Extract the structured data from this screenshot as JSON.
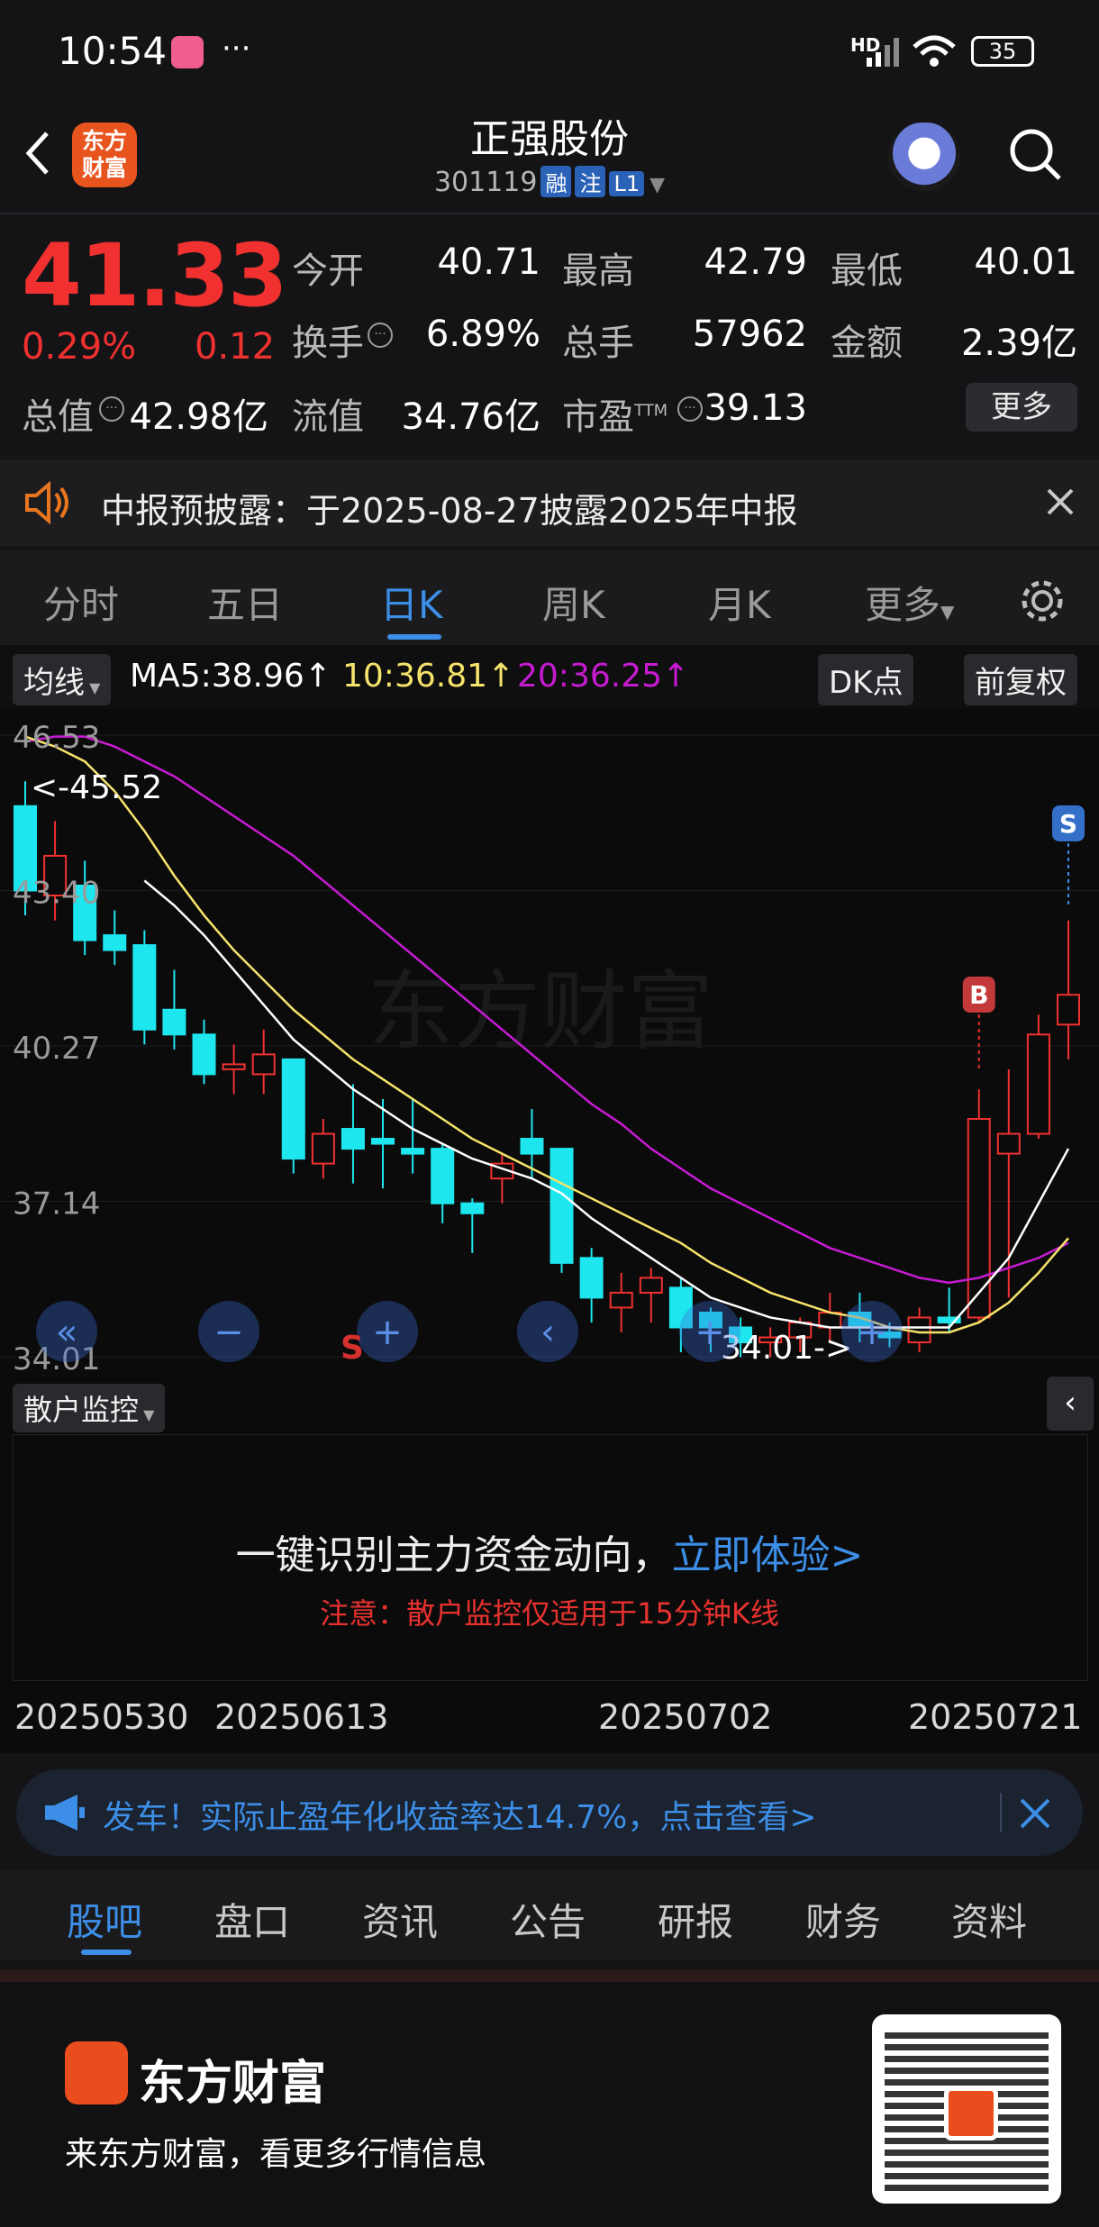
{
  "status_bar": {
    "time": "10:54",
    "app_badge": "bilibili",
    "dots": "···",
    "network": "HD",
    "battery": "35"
  },
  "header": {
    "back_icon": "chevron-left-icon",
    "logo_text": "东方\n财富",
    "title": "正强股份",
    "code": "301119",
    "tags": [
      "融",
      "注",
      "L1"
    ],
    "dropdown_icon": "caret-down-icon",
    "robot_icon": "robot-avatar-icon",
    "search_icon": "search-icon"
  },
  "quote": {
    "price": "41.33",
    "change_pct": "0.29%",
    "change": "0.12",
    "open_label": "今开",
    "open": "40.71",
    "high_label": "最高",
    "high": "42.79",
    "low_label": "最低",
    "low": "40.01",
    "turnover_label": "换手",
    "turnover": "6.89%",
    "volume_label": "总手",
    "volume": "57962",
    "amount_label": "金额",
    "amount": "2.39亿",
    "mktcap_label": "总值",
    "mktcap": "42.98亿",
    "float_label": "流值",
    "float": "34.76亿",
    "pe_label": "市盈",
    "pe_sup": "TTM",
    "pe": "39.13",
    "more": "更多"
  },
  "notice": {
    "text": "中报预披露：于2025-08-27披露2025年中报"
  },
  "tabs": [
    "分时",
    "五日",
    "日K",
    "周K",
    "月K",
    "更多"
  ],
  "active_tab": 2,
  "chart_toolbar": {
    "ma_select": "均线",
    "ma5": "MA5:38.96↑",
    "ma10": "10:36.81↑",
    "ma20": "20:36.25↑",
    "dk": "DK点",
    "adjust": "前复权"
  },
  "chart_data": {
    "type": "candlestick",
    "y_ticks": [
      "46.53",
      "43.40",
      "40.27",
      "37.14",
      "34.01"
    ],
    "ylim": [
      34.01,
      46.53
    ],
    "max_marker": "<-45.52",
    "min_marker": "34.01->",
    "x_ticks": [
      "20250530",
      "20250613",
      "20250702",
      "20250721"
    ],
    "buy_marker": "B",
    "sell_marker": "S",
    "candles": [
      {
        "o": 45.1,
        "c": 43.4,
        "h": 45.6,
        "l": 42.9
      },
      {
        "o": 43.3,
        "c": 44.1,
        "h": 44.8,
        "l": 42.8
      },
      {
        "o": 43.5,
        "c": 42.4,
        "h": 44.0,
        "l": 42.1
      },
      {
        "o": 42.5,
        "c": 42.2,
        "h": 43.0,
        "l": 41.9
      },
      {
        "o": 42.3,
        "c": 40.6,
        "h": 42.6,
        "l": 40.3
      },
      {
        "o": 41.0,
        "c": 40.5,
        "h": 41.8,
        "l": 40.2
      },
      {
        "o": 40.5,
        "c": 39.7,
        "h": 40.8,
        "l": 39.5
      },
      {
        "o": 39.8,
        "c": 39.9,
        "h": 40.3,
        "l": 39.3
      },
      {
        "o": 39.7,
        "c": 40.1,
        "h": 40.6,
        "l": 39.3
      },
      {
        "o": 40.0,
        "c": 38.0,
        "h": 40.0,
        "l": 37.7
      },
      {
        "o": 37.9,
        "c": 38.5,
        "h": 38.8,
        "l": 37.6
      },
      {
        "o": 38.6,
        "c": 38.2,
        "h": 39.5,
        "l": 37.5
      },
      {
        "o": 38.4,
        "c": 38.3,
        "h": 39.2,
        "l": 37.4
      },
      {
        "o": 38.2,
        "c": 38.1,
        "h": 39.2,
        "l": 37.7
      },
      {
        "o": 38.2,
        "c": 37.1,
        "h": 38.3,
        "l": 36.7
      },
      {
        "o": 37.1,
        "c": 36.9,
        "h": 37.2,
        "l": 36.1
      },
      {
        "o": 37.6,
        "c": 37.9,
        "h": 38.1,
        "l": 37.1
      },
      {
        "o": 38.4,
        "c": 38.1,
        "h": 39.0,
        "l": 37.6
      },
      {
        "o": 38.2,
        "c": 35.9,
        "h": 38.2,
        "l": 35.7
      },
      {
        "o": 36.0,
        "c": 35.2,
        "h": 36.2,
        "l": 34.7
      },
      {
        "o": 35.0,
        "c": 35.3,
        "h": 35.7,
        "l": 34.5
      },
      {
        "o": 35.3,
        "c": 35.6,
        "h": 35.8,
        "l": 34.7
      },
      {
        "o": 35.4,
        "c": 34.6,
        "h": 35.6,
        "l": 34.1
      },
      {
        "o": 34.9,
        "c": 34.6,
        "h": 35.0,
        "l": 34.1
      },
      {
        "o": 34.6,
        "c": 34.3,
        "h": 34.8,
        "l": 34.0
      },
      {
        "o": 34.3,
        "c": 34.4,
        "h": 34.6,
        "l": 34.0
      },
      {
        "o": 34.4,
        "c": 34.7,
        "h": 34.8,
        "l": 34.1
      },
      {
        "o": 34.6,
        "c": 34.9,
        "h": 35.3,
        "l": 34.3
      },
      {
        "o": 34.9,
        "c": 34.6,
        "h": 35.3,
        "l": 34.3
      },
      {
        "o": 34.5,
        "c": 34.4,
        "h": 34.7,
        "l": 34.2
      },
      {
        "o": 34.3,
        "c": 34.8,
        "h": 35.0,
        "l": 34.1
      },
      {
        "o": 34.8,
        "c": 34.7,
        "h": 35.4,
        "l": 34.5
      },
      {
        "o": 34.8,
        "c": 38.8,
        "h": 39.4,
        "l": 34.7
      },
      {
        "o": 38.1,
        "c": 38.5,
        "h": 39.8,
        "l": 35.2
      },
      {
        "o": 38.5,
        "c": 40.5,
        "h": 40.9,
        "l": 38.4
      },
      {
        "o": 40.7,
        "c": 41.3,
        "h": 42.8,
        "l": 40.0
      }
    ],
    "ma5": [
      null,
      null,
      null,
      null,
      43.6,
      43.1,
      42.5,
      41.8,
      41.1,
      40.4,
      39.9,
      39.4,
      39.0,
      38.6,
      38.3,
      38.0,
      37.8,
      37.6,
      37.3,
      36.8,
      36.4,
      36.0,
      35.6,
      35.2,
      35.0,
      34.8,
      34.7,
      34.6,
      34.6,
      34.6,
      34.6,
      34.6,
      35.3,
      36.0,
      37.1,
      38.2
    ],
    "ma10": [
      46.5,
      46.3,
      46.0,
      45.4,
      44.6,
      43.7,
      42.9,
      42.2,
      41.6,
      41.0,
      40.5,
      40.0,
      39.6,
      39.2,
      38.8,
      38.4,
      38.1,
      37.8,
      37.5,
      37.2,
      36.9,
      36.6,
      36.3,
      35.9,
      35.6,
      35.3,
      35.1,
      34.9,
      34.8,
      34.6,
      34.5,
      34.5,
      34.7,
      35.1,
      35.7,
      36.4
    ],
    "ma20": [
      46.4,
      46.5,
      46.5,
      46.3,
      46.0,
      45.7,
      45.3,
      44.9,
      44.5,
      44.1,
      43.6,
      43.1,
      42.6,
      42.1,
      41.6,
      41.1,
      40.6,
      40.1,
      39.6,
      39.1,
      38.7,
      38.2,
      37.8,
      37.4,
      37.1,
      36.8,
      36.5,
      36.2,
      36.0,
      35.8,
      35.6,
      35.5,
      35.6,
      35.8,
      36.0,
      36.3
    ]
  },
  "chart_controls": [
    "double-left-icon",
    "minus-icon",
    "plus-icon",
    "chevron-left-icon",
    "plus-icon",
    "plus-icon"
  ],
  "watermark": "东方财富",
  "retail": {
    "select": "散户监控",
    "headline": "一键识别主力资金动向，",
    "cta": "立即体验>",
    "note": "注意：散户监控仅适用于15分钟K线"
  },
  "promo": {
    "text": "发车！实际止盈年化收益率达14.7%，点击查看>"
  },
  "bottom_tabs": [
    "股吧",
    "盘口",
    "资讯",
    "公告",
    "研报",
    "财务",
    "资料"
  ],
  "bottom_active": 0,
  "footer": {
    "brand": "东方财富",
    "slogan": "来东方财富，看更多行情信息"
  },
  "colors": {
    "up": "#f0312f",
    "down": "#1de6ee",
    "ma5": "#ffffff",
    "ma10": "#f6e36b",
    "ma20": "#c61bd1",
    "accent": "#3c8ee6"
  }
}
